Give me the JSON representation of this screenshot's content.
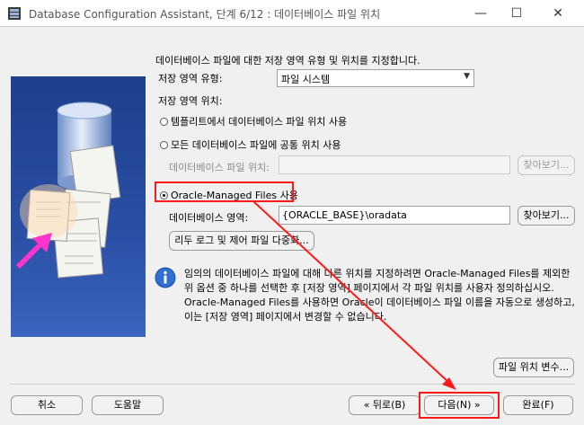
{
  "window": {
    "title": "Database Configuration Assistant, 단계 6/12 : 데이터베이스 파일 위치",
    "minimize_glyph": "—",
    "maximize_glyph": "☐",
    "close_glyph": "✕"
  },
  "intro": "데이터베이스 파일에 대한 저장 영역 유형 및 위치를 지정합니다.",
  "storage_type": {
    "label": "저장 영역 유형:",
    "value": "파일 시스템"
  },
  "storage_location": {
    "label": "저장 영역 위치:",
    "option_template": "템플리트에서 데이터베이스 파일 위치 사용",
    "option_common": "모든 데이터베이스 파일에 공통 위치 사용",
    "db_file_location_label": "데이터베이스 파일 위치:",
    "db_file_location_value": "",
    "browse_label_1": "찾아보기...",
    "option_omf": "Oracle-Managed Files 사용",
    "db_area_label": "데이터베이스 영역:",
    "db_area_value": "{ORACLE_BASE}\\oradata",
    "browse_label_2": "찾아보기...",
    "redo_button": "리두 로그 및 제어 파일 다중화..."
  },
  "info_lines": [
    "임의의 데이터베이스 파일에 대해 다른 위치를 지정하려면 Oracle-Managed Files를 제외한",
    "위 옵션 중 하나를 선택한 후 [저장 영역] 페이지에서 각 파일 위치를 사용자 정의하십시오.",
    "Oracle-Managed Files를 사용하면 Oracle이 데이터베이스 파일 이름을 자동으로 생성하고,",
    "이는 [저장 영역] 페이지에서 변경할 수 없습니다."
  ],
  "file_location_vars_button": "파일 위치 변수...",
  "footer": {
    "cancel": "취소",
    "help": "도움말",
    "back": "뒤로(B)",
    "next": "다음(N)",
    "finish": "완료(F)"
  },
  "colors": {
    "annotation": "#ff1a1a",
    "selected_radio_fill": "#000000",
    "side_panel": "#2a4fa5"
  }
}
